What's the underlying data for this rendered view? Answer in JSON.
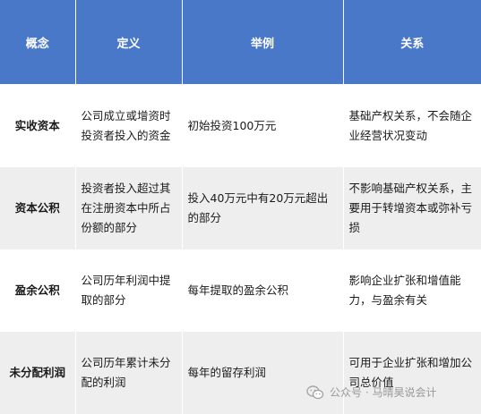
{
  "table": {
    "headers": [
      "概念",
      "定义",
      "举例",
      "关系"
    ],
    "rows": [
      {
        "concept": "实收资本",
        "definition": "公司成立或增资时投资者投入的资金",
        "example": "初始投资100万元",
        "relation": "基础产权关系，不会随企业经营状况变动"
      },
      {
        "concept": "资本公积",
        "definition": "投资者投入超过其在注册资本中所占份额的部分",
        "example": "投入40万元中有20万元超出的部分",
        "relation": "不影响基础产权关系，主要用于转增资本或弥补亏损"
      },
      {
        "concept": "盈余公积",
        "definition": "公司历年利润中提取的部分",
        "example": "每年提取的盈余公积",
        "relation": "影响企业扩张和增值能力，与盈余有关"
      },
      {
        "concept": "未分配利润",
        "definition": "公司历年累计未分配的利润",
        "example": "每年的留存利润",
        "relation": "可用于企业扩张和增加公司总价值"
      }
    ]
  },
  "watermark": {
    "text": "公众号 · 马晴昊说会计",
    "icon": "wechat-icon"
  },
  "colors": {
    "header_bg": "#4a78c8",
    "header_text": "#ffffff",
    "alt_row_bg": "#eeeeee"
  }
}
